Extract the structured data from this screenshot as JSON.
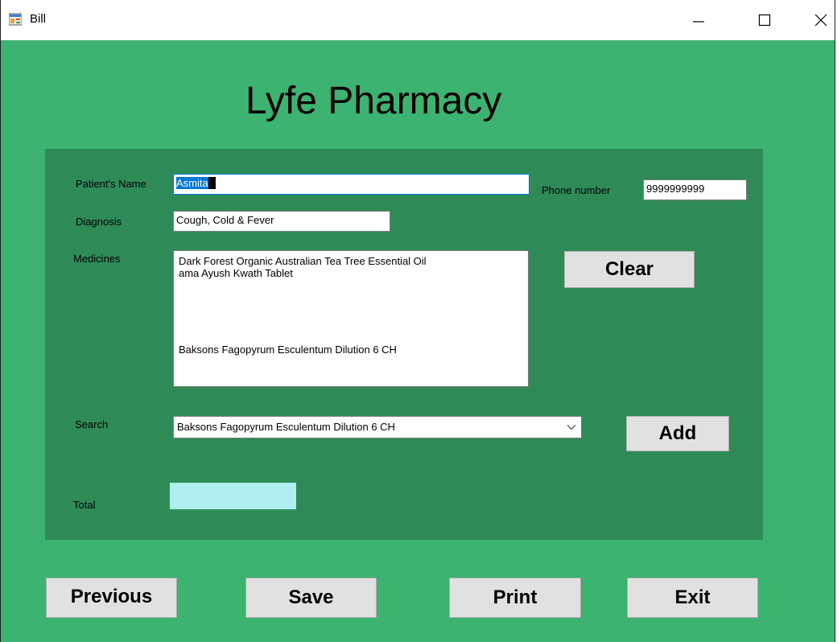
{
  "window": {
    "title": "Bill",
    "icon": "app-form-icon"
  },
  "heading": "Lyfe Pharmacy",
  "form": {
    "patient_label": "Patient's Name",
    "patient_value": "Asmita",
    "phone_label": "Phone number",
    "phone_value": "9999999999",
    "diagnosis_label": "Diagnosis",
    "diagnosis_value": "Cough, Cold & Fever",
    "medicines_label": "Medicines",
    "medicines": [
      "Dark Forest Organic Australian Tea Tree Essential Oil",
      "ama Ayush Kwath Tablet",
      "Baksons Fagopyrum Esculentum Dilution 6 CH"
    ],
    "search_label": "Search",
    "search_value": "Baksons Fagopyrum Esculentum Dilution 6 CH",
    "total_label": "Total",
    "total_value": ""
  },
  "buttons": {
    "clear": "Clear",
    "add": "Add",
    "previous": "Previous",
    "save": "Save",
    "print": "Print",
    "exit": "Exit"
  },
  "colors": {
    "window_bg": "#3cb371",
    "panel_bg": "#2e8b57",
    "total_bg": "#afeeee",
    "selection": "#0078d7"
  }
}
